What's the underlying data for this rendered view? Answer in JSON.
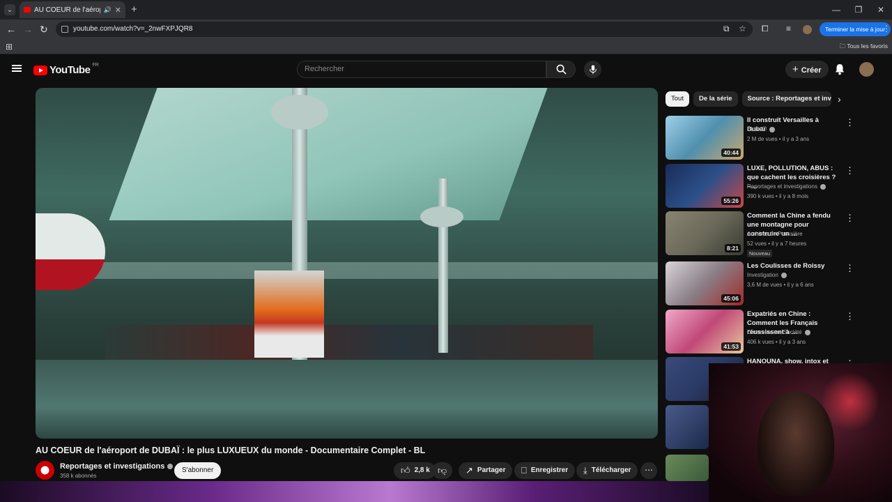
{
  "browser": {
    "tab_title": "AU COEUR de l'aéroport de",
    "url": "youtube.com/watch?v=_2nwFXPJQR8",
    "update_button": "Terminer la mise à jour",
    "bookmarks_all": "Tous les favoris"
  },
  "header": {
    "logo": "YouTube",
    "region": "FR",
    "search_placeholder": "Rechercher",
    "create_label": "Créer"
  },
  "video": {
    "title": "AU COEUR de l'aéroport de DUBAÏ : le plus LUXUEUX du monde - Documentaire Complet - BL",
    "channel": "Reportages et investigations",
    "subscribers": "358 k abonnés",
    "subscribe_label": "S'abonner",
    "likes": "2,8 k",
    "share_label": "Partager",
    "save_label": "Enregistrer",
    "download_label": "Télécharger"
  },
  "chips": [
    "Tout",
    "De la série",
    "Source : Reportages et inves"
  ],
  "recommendations": [
    {
      "title": "Il construit Versailles à Dubaï",
      "channel": "BLING !",
      "meta": "2 M de vues • il y a 3 ans",
      "duration": "40:44",
      "thumb_color": "#4f8fae"
    },
    {
      "title": "LUXE, POLLUTION, ABUS : que cachent les croisières ? –…",
      "channel": "Reportages et investigations",
      "meta": "390 k vues • il y a 8 mois",
      "duration": "55:26",
      "thumb_color": "#2b4f88"
    },
    {
      "title": "Comment la Chine a fendu une montagne pour construire un …",
      "channel": "Archives de Poussière",
      "meta": "52 vues • il y a 7 heures",
      "duration": "8:21",
      "badge": "Nouveau",
      "thumb_color": "#6b6a5a"
    },
    {
      "title": "Les Coulisses de Roissy",
      "channel": "Investigation",
      "meta": "3,6 M de vues • il y a 6 ans",
      "duration": "45:06",
      "thumb_color": "#8a7e86"
    },
    {
      "title": "Expatriés en Chine : Comment les Français réussissent à …",
      "channel": "Documentaire Société",
      "meta": "406 k vues • il y a 3 ans",
      "duration": "41:53",
      "thumb_color": "#c04878"
    },
    {
      "title": "HANOUNA, show, intox et",
      "channel": "",
      "meta": "",
      "duration": "",
      "thumb_color": "#2a3a66"
    }
  ]
}
